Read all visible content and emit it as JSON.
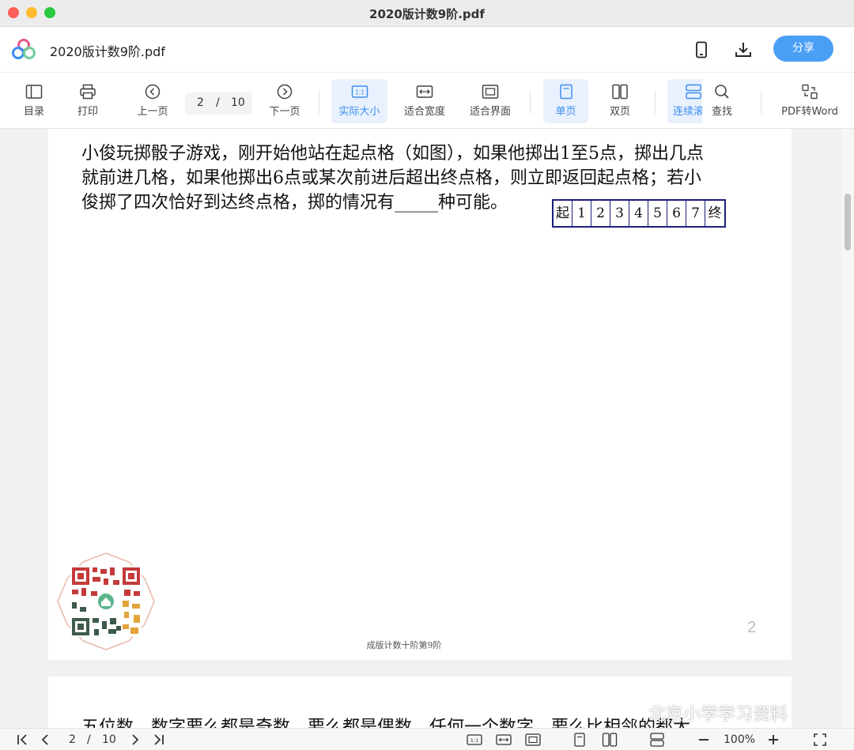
{
  "window": {
    "title": "2020版计数9阶.pdf"
  },
  "header": {
    "doc_name": "2020版计数9阶.pdf",
    "share_label": "分享"
  },
  "toolbar": {
    "toc": "目录",
    "print": "打印",
    "prev": "上一页",
    "page_current": "2",
    "page_sep": "/",
    "page_total": "10",
    "next": "下一页",
    "actual_size": "实际大小",
    "fit_width": "适合宽度",
    "fit_page": "适合界面",
    "single": "单页",
    "double": "双页",
    "continuous": "连续滚",
    "find": "查找",
    "pdf_word": "PDF转Word"
  },
  "document": {
    "problem_lines": [
      "小俊玩掷骰子游戏，刚开始他站在起点格（如图），如果他掷出1至5点，掷出几点",
      "就前进几格，如果他掷出6点或某次前进后超出终点格，则立即返回起点格；若小",
      "俊掷了四次恰好到达终点格，掷的情况有_____种可能。"
    ],
    "board_cells": [
      "起",
      "1",
      "2",
      "3",
      "4",
      "5",
      "6",
      "7",
      "终"
    ],
    "footer": "成版计数十阶第9阶",
    "page_number": "2",
    "next_page_text": "五位数，数字要么都是奇数，要么都是偶数，任何一个数字，要么比相邻的都大"
  },
  "statusbar": {
    "page_current": "2",
    "page_sep": "/",
    "page_total": "10",
    "zoom": "100%"
  },
  "watermark": "北京小学学习资料",
  "colors": {
    "accent": "#4a9ff5",
    "active_bg": "#e8f1fd",
    "board_border": "#1a1f7a"
  }
}
